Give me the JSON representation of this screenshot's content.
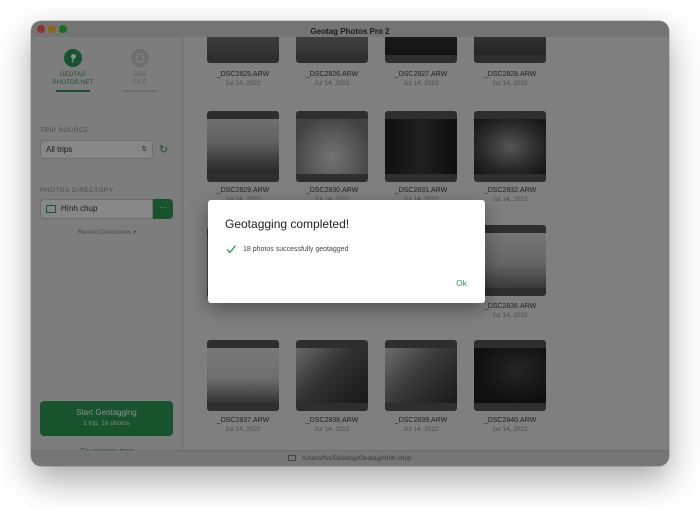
{
  "window": {
    "title": "Geotag Photos Pro 2"
  },
  "sidebar": {
    "tabs": [
      {
        "label": "GEOTAG\nPHOTOS.NET",
        "line1": "GEOTAG",
        "line2": "PHOTOS.NET",
        "active": true,
        "icon": "pin-icon"
      },
      {
        "label": "GPX\nFILE",
        "line1": "GPX",
        "line2": "FILE",
        "active": false,
        "icon": "file-icon"
      }
    ],
    "trip_source_label": "TRIP SOURCE",
    "trip_source_value": "All trips",
    "photos_dir_label": "PHOTOS DIRECTORY",
    "photos_dir_value": "Hình chụp",
    "dir_button": "···",
    "recent_label": "Recent Directories ▾",
    "start_button": "Start Geotagging",
    "start_sub": "1 trip, 18 photos",
    "fix_camera": "Fix camera time"
  },
  "grid": {
    "photos": [
      {
        "name": "_DSC2825.ARW",
        "date": "Jul 14, 2022"
      },
      {
        "name": "_DSC2826.ARW",
        "date": "Jul 14, 2022"
      },
      {
        "name": "_DSC2827.ARW",
        "date": "Jul 14, 2022"
      },
      {
        "name": "_DSC2828.ARW",
        "date": "Jul 14, 2022"
      },
      {
        "name": "_DSC2829.ARW",
        "date": "Jul 14, 2022"
      },
      {
        "name": "_DSC2830.ARW",
        "date": "Jul 14, 2022"
      },
      {
        "name": "_DSC2831.ARW",
        "date": "Jul 14, 2022"
      },
      {
        "name": "_DSC2832.ARW",
        "date": "Jul 14, 2022"
      },
      {
        "name": "_DSC2836.ARW",
        "date": "Jul 14, 2022"
      },
      {
        "name": "_DSC2837.ARW",
        "date": "Jul 14, 2022"
      },
      {
        "name": "_DSC2838.ARW",
        "date": "Jul 14, 2022"
      },
      {
        "name": "_DSC2839.ARW",
        "date": "Jul 14, 2022"
      },
      {
        "name": "_DSC2840.ARW",
        "date": "Jul 14, 2022"
      }
    ]
  },
  "statusbar": {
    "path": "/Users/fox/Desktop/Geotag/Hình chụp"
  },
  "dialog": {
    "title": "Geotagging completed!",
    "message": "18 photos successfully geotagged",
    "ok": "Ok"
  },
  "colors": {
    "accent": "#2a9a52"
  }
}
